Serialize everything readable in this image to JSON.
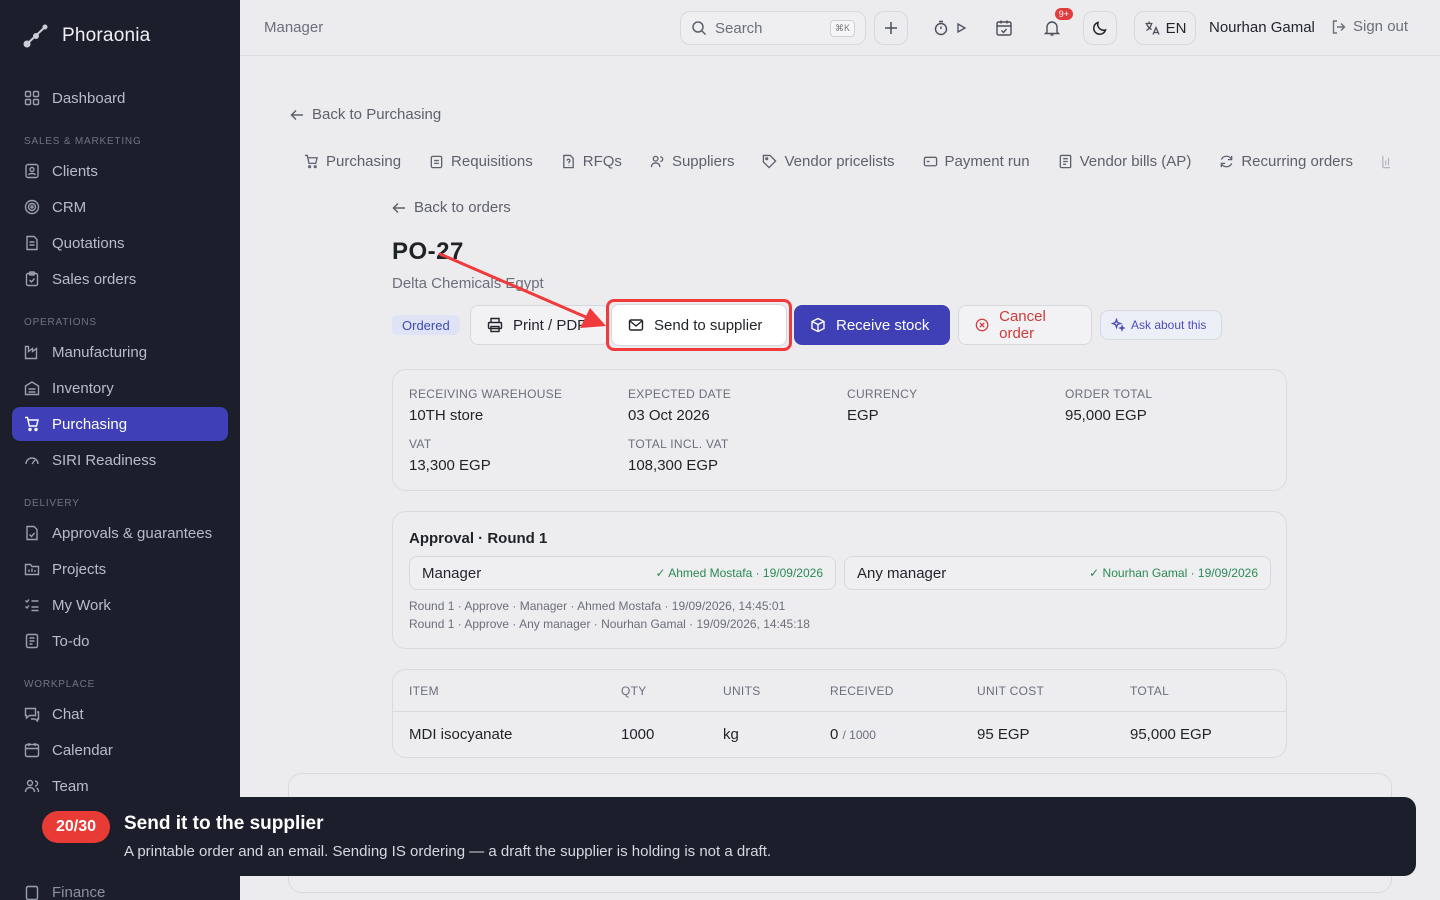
{
  "app": {
    "name": "Phoraonia"
  },
  "sidebar": {
    "dashboard": "Dashboard",
    "sections": {
      "sales": "SALES & MARKETING",
      "operations": "OPERATIONS",
      "delivery": "DELIVERY",
      "workplace": "WORKPLACE"
    },
    "items": {
      "clients": "Clients",
      "crm": "CRM",
      "quotations": "Quotations",
      "sales_orders": "Sales orders",
      "manufacturing": "Manufacturing",
      "inventory": "Inventory",
      "purchasing": "Purchasing",
      "siri": "SIRI Readiness",
      "approvals": "Approvals & guarantees",
      "projects": "Projects",
      "my_work": "My Work",
      "todo": "To-do",
      "chat": "Chat",
      "calendar": "Calendar",
      "team": "Team",
      "finance": "Finance"
    }
  },
  "topbar": {
    "breadcrumb": "Manager",
    "search_placeholder": "Search",
    "search_shortcut": "⌘K",
    "notifications_badge": "9+",
    "language": "EN",
    "user": "Nourhan Gamal",
    "sign_out": "Sign out"
  },
  "page": {
    "back_purchasing": "Back to Purchasing",
    "tabs": [
      "Purchasing",
      "Requisitions",
      "RFQs",
      "Suppliers",
      "Vendor pricelists",
      "Payment run",
      "Vendor bills (AP)",
      "Recurring orders"
    ],
    "back_orders": "Back to orders",
    "po_number": "PO-27",
    "supplier": "Delta Chemicals Egypt",
    "status": "Ordered",
    "actions": {
      "print": "Print / PDF",
      "send": "Send to supplier",
      "receive": "Receive stock",
      "cancel": "Cancel order",
      "ask": "Ask about this"
    },
    "summary": {
      "warehouse_label": "RECEIVING WAREHOUSE",
      "warehouse": "10TH store",
      "expected_label": "EXPECTED DATE",
      "expected": "03 Oct 2026",
      "currency_label": "CURRENCY",
      "currency": "EGP",
      "total_label": "ORDER TOTAL",
      "total": "95,000 EGP",
      "vat_label": "VAT",
      "vat": "13,300 EGP",
      "incl_label": "TOTAL INCL. VAT",
      "incl": "108,300 EGP"
    },
    "approval": {
      "title": "Approval · Round 1",
      "boxes": [
        {
          "role": "Manager",
          "status": "✓ Ahmed Mostafa · 19/09/2026"
        },
        {
          "role": "Any manager",
          "status": "✓ Nourhan Gamal · 19/09/2026"
        }
      ],
      "log": [
        "Round 1 · Approve · Manager · Ahmed Mostafa · 19/09/2026, 14:45:01",
        "Round 1 · Approve · Any manager · Nourhan Gamal · 19/09/2026, 14:45:18"
      ]
    },
    "lines": {
      "headers": [
        "ITEM",
        "QTY",
        "UNITS",
        "RECEIVED",
        "UNIT COST",
        "TOTAL"
      ],
      "rows": [
        {
          "item": "MDI isocyanate",
          "qty": "1000",
          "units": "kg",
          "received": "0",
          "received_of": "/ 1000",
          "unit_cost": "95 EGP",
          "total": "95,000 EGP"
        }
      ]
    }
  },
  "tour": {
    "step": "20/30",
    "title": "Send it to the supplier",
    "body": "A printable order and an email. Sending IS ordering — a draft the supplier is holding is not a draft."
  },
  "colors": {
    "sidebar_bg": "#1c1f2b",
    "accent": "#4040b6",
    "danger": "#e93b35",
    "success": "#2a8a52"
  }
}
